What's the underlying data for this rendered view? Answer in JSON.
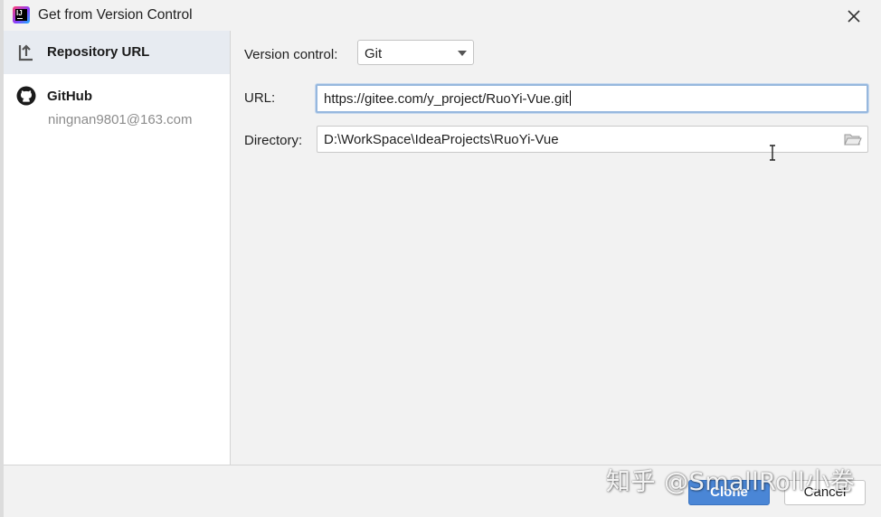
{
  "window": {
    "title": "Get from Version Control"
  },
  "sidebar": {
    "items": [
      {
        "label": "Repository URL",
        "icon": "vcs-download-icon",
        "selected": true
      },
      {
        "label": "GitHub",
        "sublabel": "ningnan9801@163.com",
        "icon": "github-icon",
        "selected": false
      }
    ]
  },
  "form": {
    "version_control_label": "Version control:",
    "version_control_value": "Git",
    "url_label": "URL:",
    "url_value": "https://gitee.com/y_project/RuoYi-Vue.git",
    "directory_label": "Directory:",
    "directory_value": "D:\\WorkSpace\\IdeaProjects\\RuoYi-Vue"
  },
  "footer": {
    "clone_label": "Clone",
    "cancel_label": "Cancel"
  },
  "watermark": "知乎 @SmallRoll小卷",
  "colors": {
    "accent": "#4a86d6",
    "selection": "#e7ebf1",
    "focus_border": "#97b8de"
  }
}
